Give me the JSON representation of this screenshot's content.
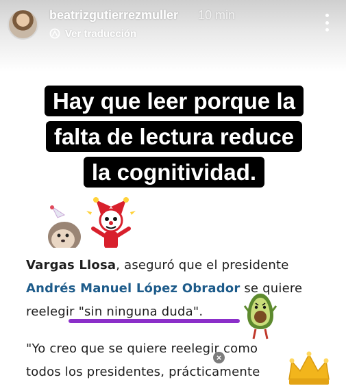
{
  "header": {
    "username": "beatrizgutierrezmuller",
    "timestamp": "10 min",
    "translate_label": "Ver traducción",
    "menu_icon": "more-vertical-icon",
    "translate_icon": "translate-icon"
  },
  "caption": {
    "text": "Hay que leer porque la falta de lectura reduce la cognitividad."
  },
  "article": {
    "line1_name": "Vargas Llosa",
    "line1_rest": ", aseguró que el presidente",
    "line2_link": "Andrés Manuel López Obrador",
    "line2_rest": " se quiere",
    "line3": "reelegir \"sin ninguna duda\".",
    "line4": "\"Yo creo que se quiere reelegir como",
    "line5": "todos los presidentes, prácticamente"
  },
  "stickers": [
    "hedgehog-party-sticker",
    "jester-sticker",
    "avocado-sticker",
    "crown-sticker"
  ],
  "colors": {
    "caption_bg": "#000000",
    "caption_text": "#ffffff",
    "link_blue": "#1d5b8a",
    "underline_purple": "#8b2fc9"
  }
}
